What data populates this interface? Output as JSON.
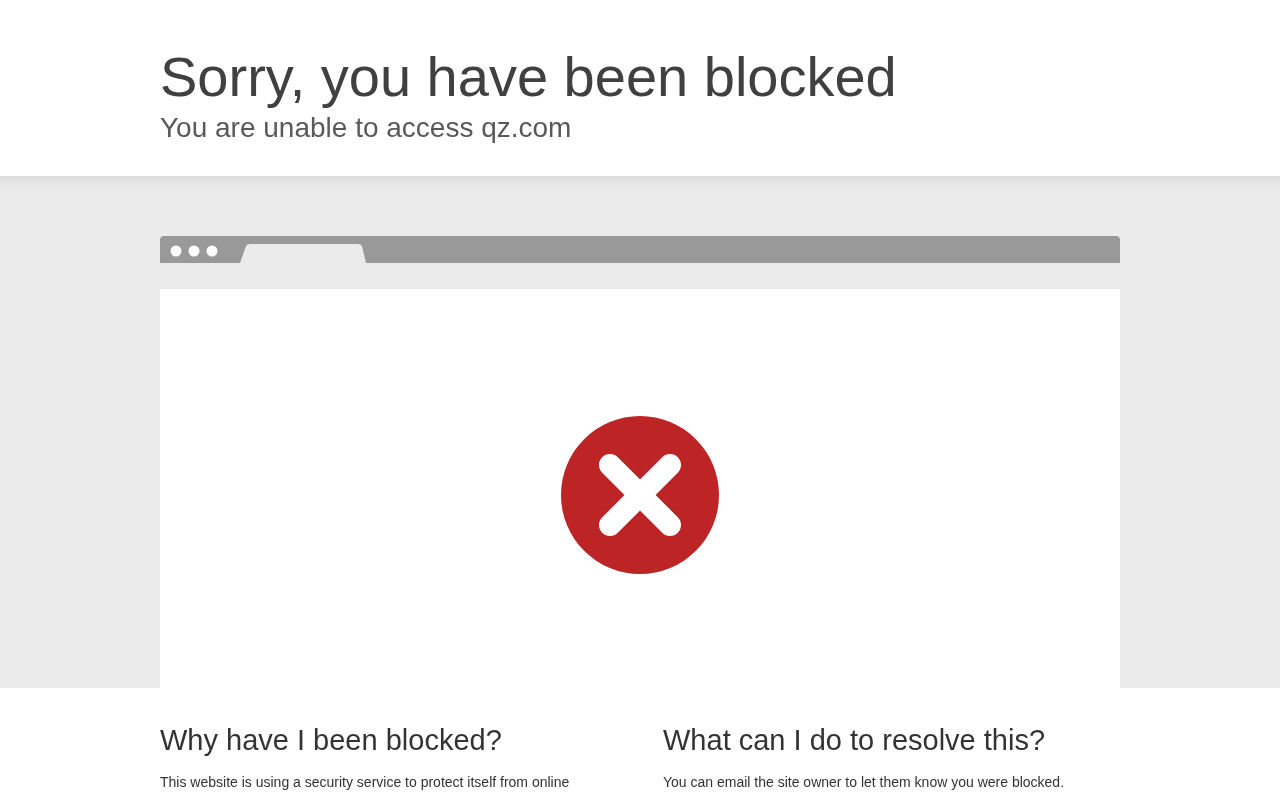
{
  "header": {
    "title": "Sorry, you have been blocked",
    "subtitle": "You are unable to access qz.com"
  },
  "sections": [
    {
      "heading": "Why have I been blocked?",
      "text": "This website is using a security service to protect itself from online"
    },
    {
      "heading": "What can I do to resolve this?",
      "text": "You can email the site owner to let them know you were blocked."
    }
  ]
}
